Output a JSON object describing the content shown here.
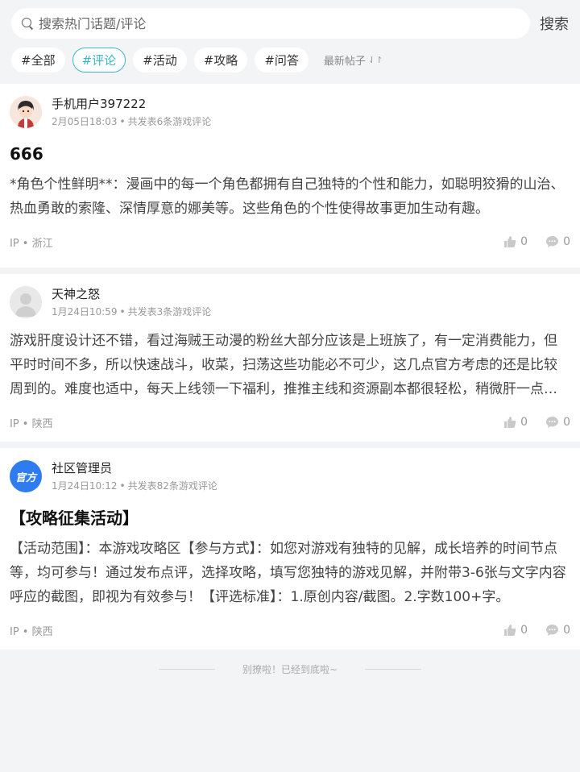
{
  "search": {
    "placeholder": "搜索热门话题/评论",
    "button_label": "搜索"
  },
  "tags": [
    {
      "label": "#全部",
      "active": false
    },
    {
      "label": "#评论",
      "active": true
    },
    {
      "label": "#活动",
      "active": false
    },
    {
      "label": "#攻略",
      "active": false
    },
    {
      "label": "#问答",
      "active": false
    }
  ],
  "sort": {
    "label": "最新帖子",
    "icon": "sort-arrows-icon"
  },
  "posts": [
    {
      "user": "手机用户397222",
      "date": "2月05日18:03",
      "count_text": "共发表6条游戏评论",
      "title": "666",
      "body": "*角色个性鲜明**：漫画中的每一个角色都拥有自己独特的个性和能力，如聪明狡猾的山治、热血勇敢的索隆、深情厚意的娜美等。这些角色的个性使得故事更加生动有趣。",
      "ip": "IP • 浙江",
      "likes": "0",
      "comments": "0"
    },
    {
      "user": "天神之怒",
      "date": "1月24日10:59",
      "count_text": "共发表3条游戏评论",
      "title": "",
      "body": "游戏肝度设计还不错，看过海贼王动漫的粉丝大部分应该是上班族了，有一定消费能力，但平时时间不多，所以快速战斗，收菜，扫荡这些功能必不可少，这几点官方考虑的还是比较周到的。难度也适中，每天上线领一下福利，推推主线和资源副本都很轻松，稍微肝一点就能跟上进度。",
      "ip": "IP • 陕西",
      "likes": "0",
      "comments": "0"
    },
    {
      "user": "社区管理员",
      "avatar_text": "官方",
      "date": "1月24日10:12",
      "count_text": "共发表82条游戏评论",
      "title": "【攻略征集活动】",
      "body": "【活动范围】：本游戏攻略区【参与方式】：如您对游戏有独特的见解，成长培养的时间节点等，均可参与！通过发布点评，选择攻略，填写您独特的游戏见解，并附带3-6张与文字内容呼应的截图，即视为有效参与！【评选标准】：1.原创内容/截图。2.字数100+字。",
      "ip": "IP • 陕西",
      "likes": "0",
      "comments": "0"
    }
  ],
  "footer": {
    "text": "别撩啦！已经到底啦~"
  },
  "colors": {
    "accent": "#39b8c6",
    "official_blue": "#2f7cf0"
  }
}
